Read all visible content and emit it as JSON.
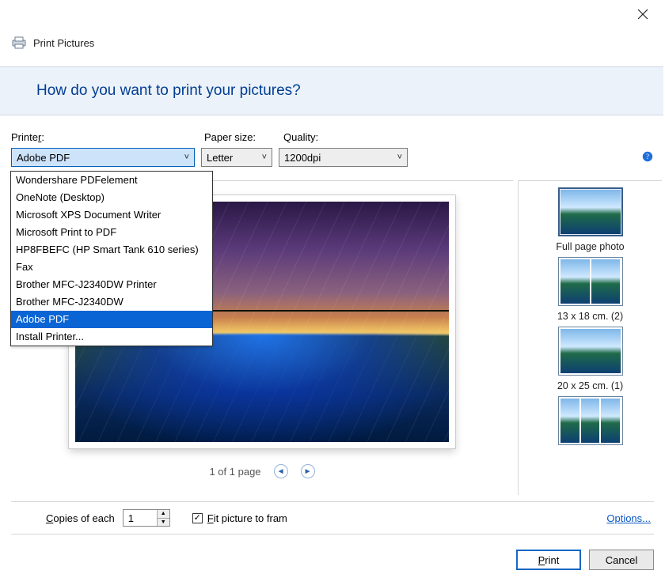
{
  "title": "Print Pictures",
  "banner_title": "How do you want to print your pictures?",
  "labels": {
    "printer_pre": "Printe",
    "printer_u": "r",
    "printer_suf": ":",
    "paper": "Paper size:",
    "quality": "Quality:",
    "copies_pre": "",
    "copies_u": "C",
    "copies_post": "opies of each",
    "fit_pre": "",
    "fit_u": "F",
    "fit_post": "it picture to fram",
    "options": "Options...",
    "print_u": "P",
    "print_post": "rint",
    "cancel": "Cancel"
  },
  "selects": {
    "printer": "Adobe PDF",
    "paper": "Letter",
    "quality": "1200dpi"
  },
  "printer_options": [
    "Wondershare PDFelement",
    "OneNote (Desktop)",
    "Microsoft XPS Document Writer",
    "Microsoft Print to PDF",
    "HP8FBEFC (HP Smart Tank 610 series)",
    "Fax",
    "Brother MFC-J2340DW Printer",
    "Brother MFC-J2340DW",
    "Adobe PDF",
    "Install Printer..."
  ],
  "printer_selected_index": 8,
  "pager": "1 of 1 page",
  "layouts": [
    {
      "label": "Full page photo",
      "count": 1
    },
    {
      "label": "13 x 18 cm. (2)",
      "count": 2
    },
    {
      "label": "20 x 25 cm. (1)",
      "count": 1
    },
    {
      "label": "",
      "count": 3
    }
  ],
  "copies_value": "1",
  "fit_checked": true
}
